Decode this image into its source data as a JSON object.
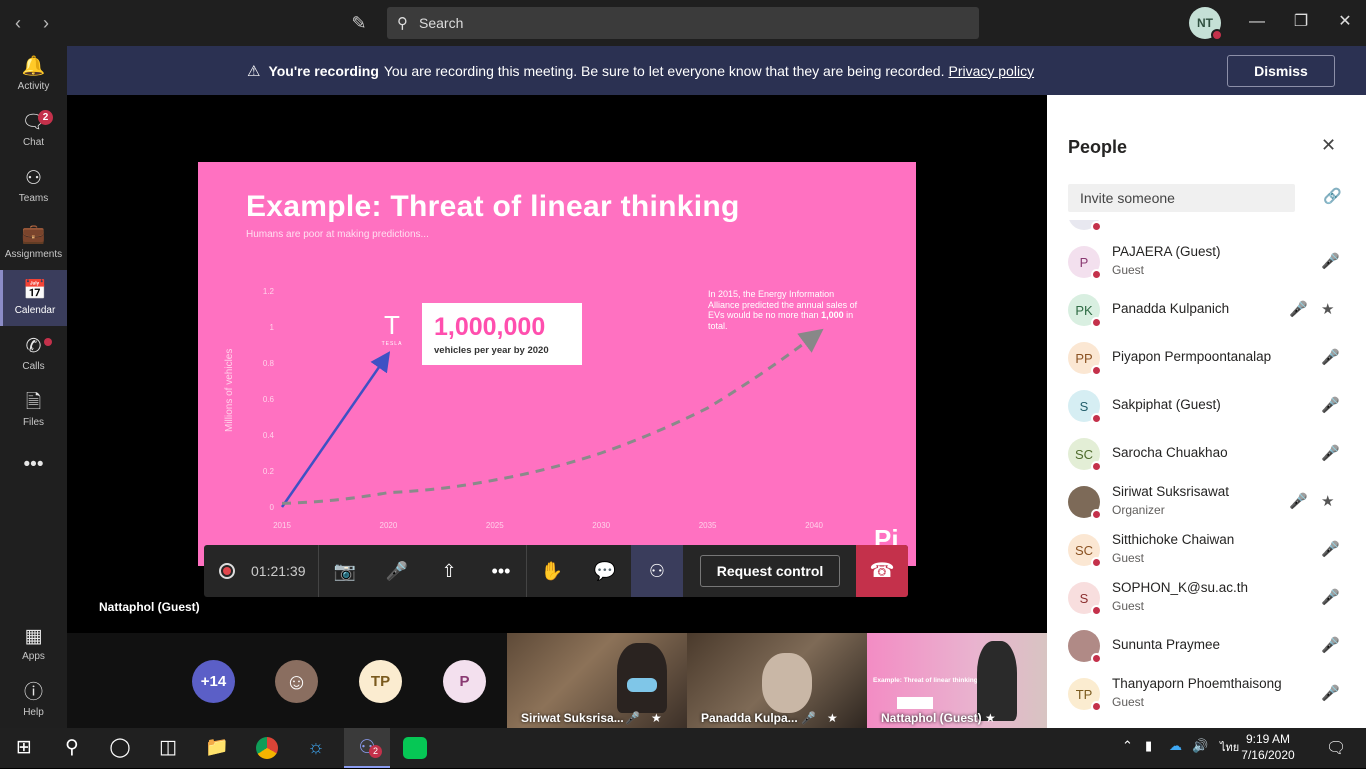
{
  "search": {
    "placeholder": "Search"
  },
  "user_initials": "NT",
  "rail": [
    {
      "label": "Activity",
      "icon": "bell-icon"
    },
    {
      "label": "Chat",
      "icon": "chat-icon",
      "badge": "2"
    },
    {
      "label": "Teams",
      "icon": "teams-icon"
    },
    {
      "label": "Assignments",
      "icon": "assignments-icon"
    },
    {
      "label": "Calendar",
      "icon": "calendar-icon"
    },
    {
      "label": "Calls",
      "icon": "phone-icon"
    },
    {
      "label": "Files",
      "icon": "files-icon"
    },
    {
      "label": "Apps",
      "icon": "apps-icon"
    },
    {
      "label": "Help",
      "icon": "help-icon"
    }
  ],
  "banner": {
    "bold": "You're recording",
    "text": "You are recording this meeting. Be sure to let everyone know that they are being recorded.",
    "link": "Privacy policy",
    "dismiss": "Dismiss"
  },
  "slide": {
    "title": "Example: Threat of linear thinking",
    "subtitle": "Humans are poor at making predictions...",
    "big_number": "1,000,000",
    "big_caption": "vehicles per year by 2020",
    "note_a": "In 2015, the Energy Information Alliance predicted the annual sales of EVs would be no more than ",
    "note_b": "1,000",
    "note_c": " in total.",
    "ylabel": "Millions of vehicles",
    "tesla_text": "TESLA",
    "logo": "Pi"
  },
  "chart_data": {
    "type": "line",
    "xlabel": "",
    "ylabel": "Millions of vehicles",
    "x": [
      "2015",
      "2020",
      "2025",
      "2030",
      "2035",
      "2040"
    ],
    "yticks": [
      "0",
      "0.2",
      "0.4",
      "0.6",
      "0.8",
      "1",
      "1.2"
    ],
    "ylim": [
      0,
      1.2
    ],
    "series": [
      {
        "style": "solid-blue-arrow",
        "points": [
          [
            2015,
            0
          ],
          [
            2020,
            0.82
          ]
        ]
      },
      {
        "style": "dashed-grey-arrow",
        "points": [
          [
            2015,
            0.02
          ],
          [
            2020,
            0.08
          ],
          [
            2025,
            0.15
          ],
          [
            2030,
            0.3
          ],
          [
            2035,
            0.55
          ],
          [
            2040,
            0.95
          ]
        ]
      }
    ]
  },
  "callbar": {
    "timer": "01:21:39",
    "request_control": "Request control"
  },
  "presenter_name": "Nattaphol (Guest)",
  "strip": {
    "overflow": "+14",
    "avatars": [
      "TP",
      "P"
    ],
    "tiles": [
      "Siriwat Suksrisa...",
      "Panadda Kulpa...",
      "Nattaphol (Guest)"
    ],
    "tile_slide_title": "Example: Threat of linear thinking"
  },
  "people": {
    "title": "People",
    "invite_placeholder": "Invite someone",
    "list": [
      {
        "initials": "P",
        "name": "PAJAERA (Guest)",
        "role": "Guest",
        "bg": "#f3e0ee",
        "fg": "#8a3a72"
      },
      {
        "initials": "PK",
        "name": "Panadda Kulpanich",
        "role": "",
        "bg": "#d9efe1",
        "fg": "#2e6b44",
        "pin": true
      },
      {
        "initials": "PP",
        "name": "Piyapon Permpoontanalap",
        "role": "",
        "bg": "#fbe7d3",
        "fg": "#8b5222"
      },
      {
        "initials": "S",
        "name": "Sakpiphat (Guest)",
        "role": "",
        "bg": "#d6eef3",
        "fg": "#235e6b"
      },
      {
        "initials": "SC",
        "name": "Sarocha Chuakhao",
        "role": "",
        "bg": "#e3eed6",
        "fg": "#4e6b2c"
      },
      {
        "initials": "",
        "name": "Siriwat Suksrisawat",
        "role": "Organizer",
        "bg": "#7d6a58",
        "fg": "#fff",
        "pin": true,
        "photo": true
      },
      {
        "initials": "SC",
        "name": "Sitthichoke Chaiwan",
        "role": "Guest",
        "bg": "#fbe7d3",
        "fg": "#8b5222"
      },
      {
        "initials": "S",
        "name": "SOPHON_K@su.ac.th",
        "role": "Guest",
        "bg": "#f8dede",
        "fg": "#8b2f2f"
      },
      {
        "initials": "",
        "name": "Sununta Praymee",
        "role": "",
        "bg": "#b08a86",
        "fg": "#fff",
        "photo": true
      },
      {
        "initials": "TP",
        "name": "Thanyaporn Phoemthaisong",
        "role": "Guest",
        "bg": "#fbecd0",
        "fg": "#7a5a1e"
      }
    ]
  },
  "taskbar": {
    "time": "9:19 AM",
    "date": "7/16/2020",
    "lang": "ไทย",
    "teams_badge": "2"
  }
}
